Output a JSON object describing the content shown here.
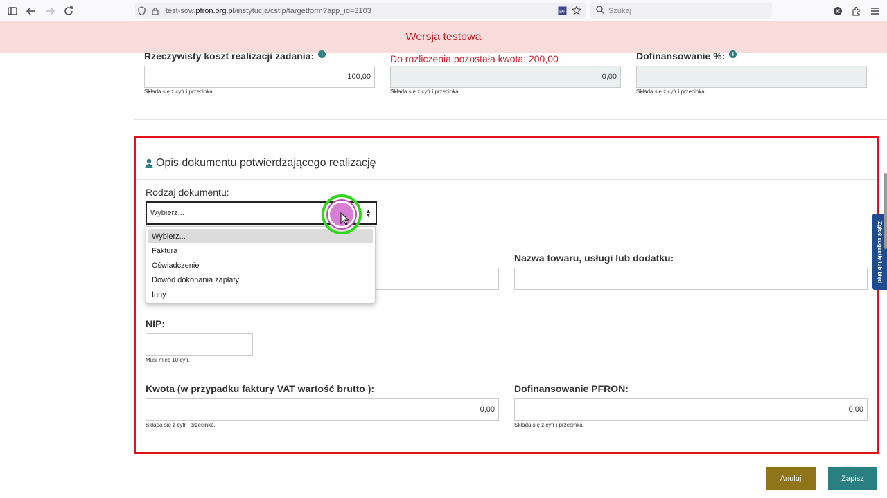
{
  "browser": {
    "url_prefix": "test-sow.",
    "url_domain": "pfron.org.pl",
    "url_path": "/instytucja/cstlp/targetform?app_id=3103",
    "search_placeholder": "Szukaj"
  },
  "banner": {
    "text": "Wersja testowa"
  },
  "top_fields": {
    "real_cost": {
      "label": "Rzeczywisty koszt realizacji zadania:",
      "value": "100,00",
      "hint": "Składa się z cyfr i przecinka."
    },
    "remaining": {
      "label": "Do rozliczenia pozostała kwota: 200,00",
      "value": "0,00",
      "hint": "Składa się z cyfr i przecinka."
    },
    "cofinancing_pct": {
      "label": "Dofinansowanie %:",
      "value": "",
      "hint": "Składa się z cyfr i przecinka."
    }
  },
  "panel": {
    "title": "Opis dokumentu potwierdzającego realizację",
    "doc_type": {
      "label": "Rodzaj dokumentu:",
      "selected": "Wybierz...",
      "options": [
        "Wybierz...",
        "Faktura",
        "Oświadczenie",
        "Dowód dokonania zapłaty",
        "Inny"
      ]
    },
    "goods_name": {
      "label": "Nazwa towaru, usługi lub dodatku:",
      "value": ""
    },
    "nip": {
      "label": "NIP:",
      "value": "",
      "hint": "Musi mieć 10 cyfr."
    },
    "amount": {
      "label": "Kwota (w przypadku faktury VAT wartość brutto ):",
      "value": "0,00",
      "hint": "Składa się z cyfr i przecinka."
    },
    "pfron_cofinancing": {
      "label": "Dofinansowanie PFRON:",
      "value": "0,00",
      "hint": "Składa się z cyfr i przecinka."
    }
  },
  "buttons": {
    "cancel": "Anuluj",
    "save": "Zapisz"
  },
  "side_tab": {
    "label": "Zgłoś sugestię lub błąd"
  },
  "colors": {
    "accent": "#2a7f80",
    "highlight": "#e0131b",
    "cancel": "#8f7418",
    "banner_bg": "#f8dcdc",
    "banner_text": "#c0262b"
  }
}
